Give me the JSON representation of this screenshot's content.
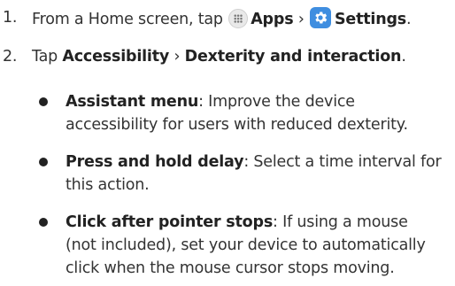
{
  "steps": [
    {
      "number": "1.",
      "pre": "From a Home screen, tap",
      "apps_label": "Apps",
      "sep": "›",
      "settings_label": "Settings",
      "end": "."
    },
    {
      "number": "2.",
      "pre": "Tap",
      "a": "Accessibility",
      "sep": "›",
      "b": "Dexterity and interaction",
      "end": "."
    }
  ],
  "bullets": [
    {
      "title": "Assistant menu",
      "line1": ": Improve the device",
      "line2": "accessibility for users with reduced dexterity."
    },
    {
      "title": "Press and hold delay",
      "line1": ": Select a time interval for",
      "line2": "this action."
    },
    {
      "title": "Click after pointer stops",
      "line1": ": If using a mouse",
      "line2": "(not included), set your device to automatically",
      "line3": "click when the mouse cursor stops moving."
    }
  ],
  "icons": {
    "apps": "apps-grid-icon",
    "settings": "gear-icon",
    "settings_color": "#3f8ee0"
  }
}
